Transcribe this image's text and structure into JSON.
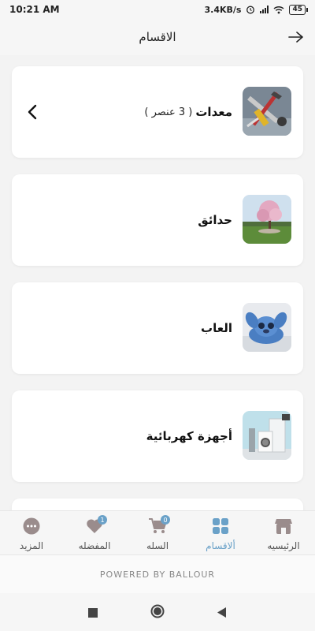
{
  "status": {
    "time": "10:21 AM",
    "speed": "3.4KB/s",
    "battery": "45"
  },
  "header": {
    "title": "الاقسام"
  },
  "categories": [
    {
      "name": "معدات",
      "count": "( 3 عنصر )",
      "expanded": true,
      "icon": "tools-image"
    },
    {
      "name": "حدائق",
      "count": "",
      "expanded": false,
      "icon": "garden-tree-image"
    },
    {
      "name": "العاب",
      "count": "",
      "expanded": false,
      "icon": "plush-toy-image"
    },
    {
      "name": "أجهزة كهربائية",
      "count": "",
      "expanded": false,
      "icon": "appliances-image"
    }
  ],
  "nav": {
    "items": [
      {
        "label": "الرئيسيه",
        "icon": "store-icon",
        "active": false
      },
      {
        "label": "ألاقسام",
        "icon": "grid-icon",
        "active": true
      },
      {
        "label": "السله",
        "icon": "cart-icon",
        "badge": "0",
        "active": false
      },
      {
        "label": "المفضله",
        "icon": "heart-icon",
        "badge": "1",
        "active": false
      },
      {
        "label": "المزيد",
        "icon": "more-icon",
        "active": false
      }
    ]
  },
  "footer": {
    "powered": "POWERED BY BALLOUR"
  },
  "colors": {
    "accent": "#6aa1c8",
    "background": "#f3f3f3",
    "card": "#ffffff"
  }
}
